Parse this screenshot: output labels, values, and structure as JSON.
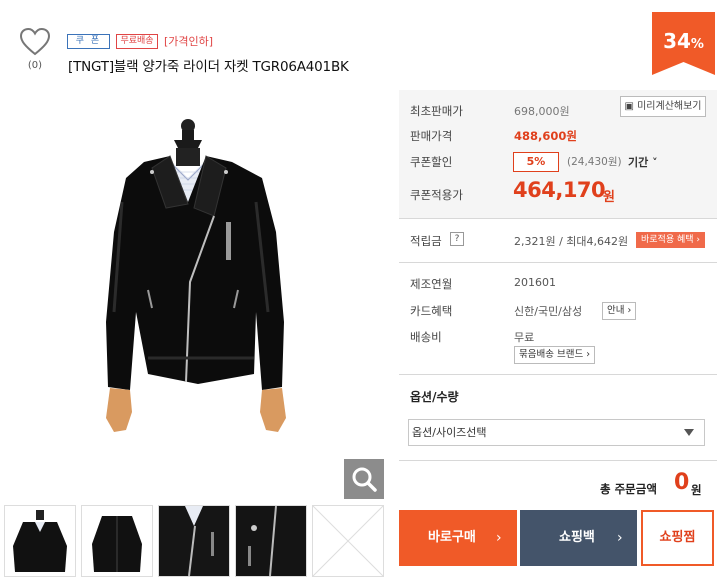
{
  "wish": {
    "icon": "heart-outline-icon",
    "count": "(0)"
  },
  "badges": {
    "coupon": "쿠 폰",
    "free_shipping": "무료배송",
    "price_cut": "[가격인하]"
  },
  "product": {
    "title": "[TNGT]블랙 양가죽 라이더 자켓 TGR06A401BK"
  },
  "discount": {
    "value": "34",
    "unit": "%"
  },
  "price": {
    "original_label": "최초판매가",
    "original_value": "698,000원",
    "calc_button": "미리계산해보기",
    "sale_label": "판매가격",
    "sale_value": "488,600원",
    "coupon_label": "쿠폰할인",
    "coupon_rate": "5%",
    "coupon_amount": "(24,430원)",
    "period_label": "기간",
    "final_label": "쿠폰적용가",
    "final_value": "464,170",
    "final_unit": "원"
  },
  "points": {
    "label": "적립금",
    "help": "?",
    "value": "2,321원 / 최대4,642원",
    "benefit_button": "바로적용 혜택 ›"
  },
  "details": {
    "manufacture_label": "제조연월",
    "manufacture_value": "201601",
    "card_label": "카드혜택",
    "card_value": "신한/국민/삼성",
    "card_info_button": "안내 ›",
    "shipping_label": "배송비",
    "shipping_value": "무료",
    "bundle_button": "묶음배송 브랜드 ›"
  },
  "option": {
    "header": "옵션/수량",
    "select_value": "옵션/사이즈선택"
  },
  "total": {
    "label": "총 주문금액",
    "value": "0",
    "unit": "원"
  },
  "actions": {
    "buy_now": "바로구매",
    "shopping_bag": "쇼핑백",
    "wishlist": "쇼핑찜",
    "arrow": "›"
  },
  "colors": {
    "accent": "#f05a28",
    "bag": "#44546a",
    "price": "#e0401c"
  }
}
